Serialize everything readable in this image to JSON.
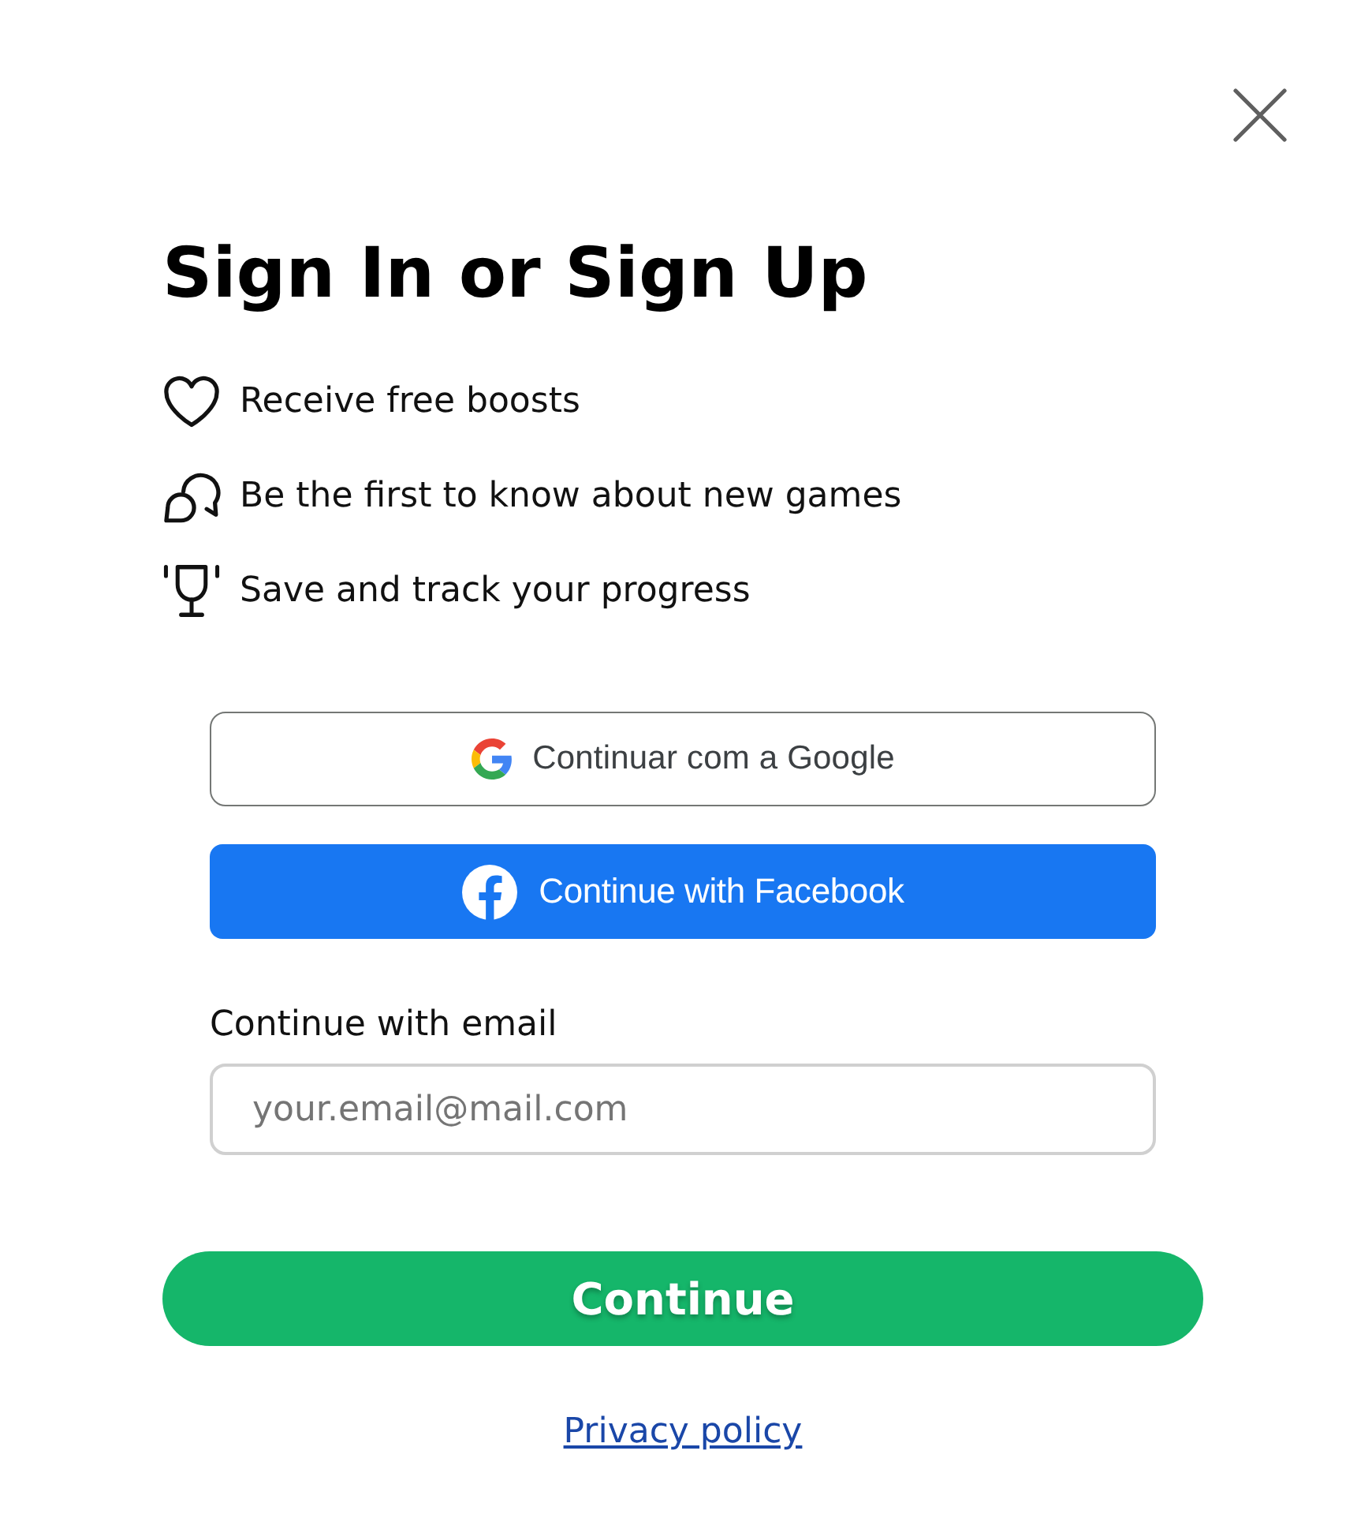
{
  "dialog": {
    "title": "Sign In or Sign Up",
    "benefits": [
      {
        "kind": "heart",
        "text": "Receive free boosts"
      },
      {
        "kind": "chat",
        "text": "Be the first to know about new games"
      },
      {
        "kind": "trophy",
        "text": "Save and track your progress"
      }
    ],
    "social_buttons": [
      {
        "kind": "google",
        "label": "Continuar com a Google"
      },
      {
        "kind": "facebook",
        "label": "Continue with Facebook"
      }
    ],
    "email": {
      "label": "Continue with email",
      "placeholder": "your.email@mail.com"
    },
    "submit_button": {
      "label": "Continue"
    },
    "privacy_link": {
      "label": "Privacy policy"
    }
  }
}
